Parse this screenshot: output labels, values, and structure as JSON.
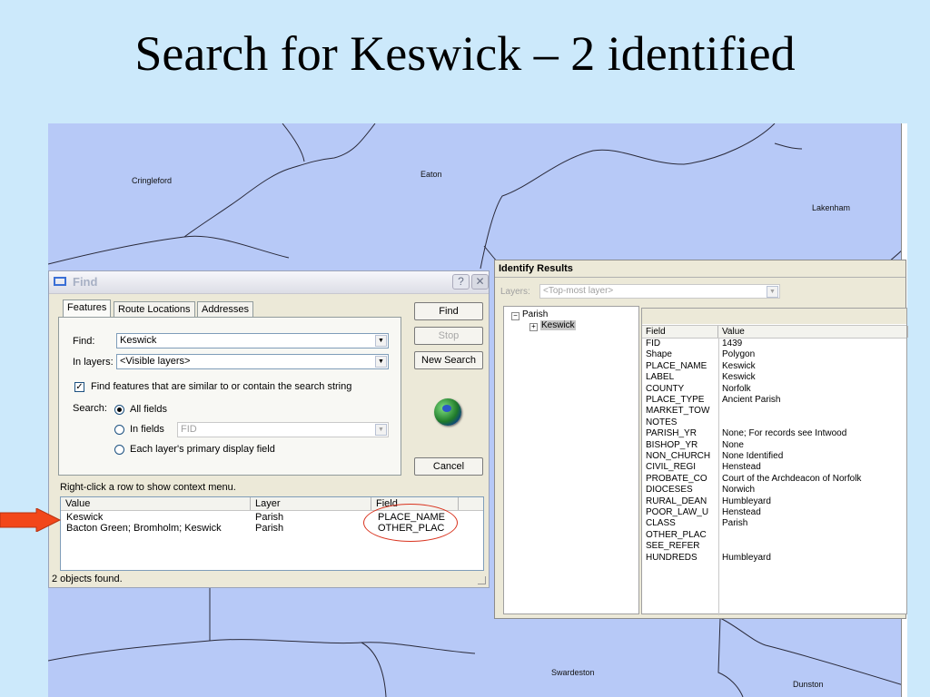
{
  "slide": {
    "title": "Search for Keswick – 2 identified"
  },
  "map": {
    "places": [
      "Cringleford",
      "Eaton",
      "Lakenham",
      "Swardeston",
      "Dunston"
    ]
  },
  "find_dialog": {
    "title": "Find",
    "help_label": "?",
    "close_label": "✕",
    "tabs": [
      "Features",
      "Route Locations",
      "Addresses"
    ],
    "find_label": "Find:",
    "find_value": "Keswick",
    "in_layers_label": "In layers:",
    "in_layers_value": "<Visible layers>",
    "similar_checkbox_label": "Find features that are similar to or contain the search string",
    "similar_checked": true,
    "search_label": "Search:",
    "search_options": [
      "All fields",
      "In fields",
      "Each layer's primary display field"
    ],
    "search_selected": "All fields",
    "in_fields_value": "FID",
    "buttons": {
      "find": "Find",
      "stop": "Stop",
      "new_search": "New Search",
      "cancel": "Cancel"
    },
    "hint": "Right-click a row to show context menu.",
    "results": {
      "columns": [
        "Value",
        "Layer",
        "Field"
      ],
      "rows": [
        {
          "value": "Keswick",
          "layer": "Parish",
          "field": "PLACE_NAME"
        },
        {
          "value": "Bacton Green; Bromholm; Keswick",
          "layer": "Parish",
          "field": "OTHER_PLAC"
        }
      ]
    },
    "status": "2 objects found."
  },
  "identify": {
    "title": "Identify Results",
    "layers_label": "Layers:",
    "layers_value": "<Top-most layer>",
    "tree": {
      "parent": "Parish",
      "child": "Keswick"
    },
    "columns": [
      "Field",
      "Value"
    ],
    "rows": [
      {
        "field": "FID",
        "value": "1439"
      },
      {
        "field": "Shape",
        "value": "Polygon"
      },
      {
        "field": "PLACE_NAME",
        "value": "Keswick"
      },
      {
        "field": "LABEL",
        "value": "Keswick"
      },
      {
        "field": "COUNTY",
        "value": "Norfolk"
      },
      {
        "field": "PLACE_TYPE",
        "value": "Ancient Parish"
      },
      {
        "field": "MARKET_TOW",
        "value": ""
      },
      {
        "field": "NOTES",
        "value": ""
      },
      {
        "field": "PARISH_YR",
        "value": "None; For records see Intwood"
      },
      {
        "field": "BISHOP_YR",
        "value": "None"
      },
      {
        "field": "NON_CHURCH",
        "value": "None Identified"
      },
      {
        "field": "CIVIL_REGI",
        "value": "Henstead"
      },
      {
        "field": "PROBATE_CO",
        "value": "Court of the Archdeacon of Norfolk"
      },
      {
        "field": "DIOCESES",
        "value": "Norwich"
      },
      {
        "field": "RURAL_DEAN",
        "value": "Humbleyard"
      },
      {
        "field": "POOR_LAW_U",
        "value": "Henstead"
      },
      {
        "field": "CLASS",
        "value": "Parish"
      },
      {
        "field": "OTHER_PLAC",
        "value": ""
      },
      {
        "field": "SEE_REFER",
        "value": ""
      },
      {
        "field": "HUNDREDS",
        "value": "Humbleyard"
      }
    ]
  },
  "colors": {
    "background": "#cce9fb",
    "map": "#b7c9f7",
    "arrow": "#f2471a",
    "highlight": "#d9331e"
  },
  "icons": [
    "find-window-icon",
    "help-icon",
    "close-icon",
    "globe-icon",
    "red-arrow-icon",
    "dropdown-arrow-icon",
    "tree-expand-icon"
  ]
}
